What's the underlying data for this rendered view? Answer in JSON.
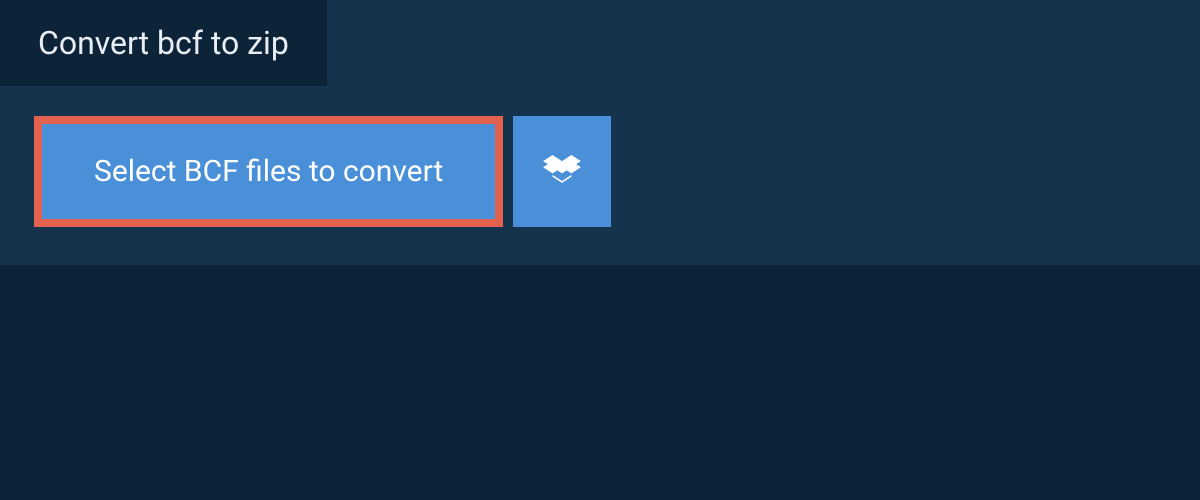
{
  "header": {
    "tab_label": "Convert bcf to zip"
  },
  "actions": {
    "select_label": "Select BCF files to convert"
  },
  "icons": {
    "dropbox": "dropbox-icon"
  },
  "colors": {
    "page_bg": "#0d2438",
    "panel_bg": "#16334d",
    "button_bg": "#4a90d9",
    "highlight_border": "#e2614f",
    "text_light": "#e8eef3",
    "text_white": "#ffffff"
  }
}
